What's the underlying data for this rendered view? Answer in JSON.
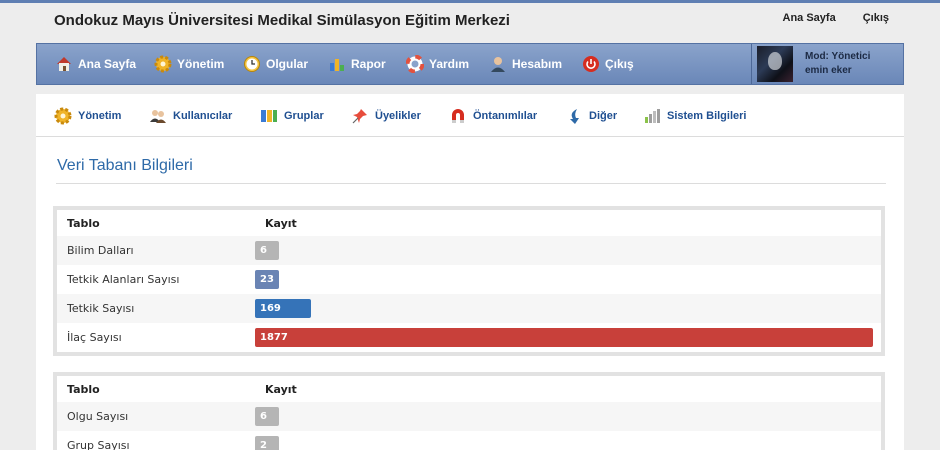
{
  "header": {
    "site_title": "Ondokuz Mayıs Üniversitesi Medikal Simülasyon Eğitim Merkezi",
    "links": [
      "Ana Sayfa",
      "Çıkış"
    ]
  },
  "mainnav": {
    "items": [
      {
        "label": "Ana Sayfa",
        "icon": "home-icon"
      },
      {
        "label": "Yönetim",
        "icon": "gear-icon"
      },
      {
        "label": "Olgular",
        "icon": "clock-icon"
      },
      {
        "label": "Rapor",
        "icon": "bar-chart-icon"
      },
      {
        "label": "Yardım",
        "icon": "lifebuoy-icon"
      },
      {
        "label": "Hesabım",
        "icon": "user-icon"
      },
      {
        "label": "Çıkış",
        "icon": "power-icon"
      }
    ],
    "user": {
      "role": "Mod: Yönetici",
      "name": "emin eker"
    }
  },
  "subnav": {
    "items": [
      {
        "label": "Yönetim",
        "icon": "gear-icon"
      },
      {
        "label": "Kullanıcılar",
        "icon": "users-icon"
      },
      {
        "label": "Gruplar",
        "icon": "groups-icon"
      },
      {
        "label": "Üyelikler",
        "icon": "pushpin-icon"
      },
      {
        "label": "Öntanımlılar",
        "icon": "magnet-icon"
      },
      {
        "label": "Diğer",
        "icon": "arrow-down-icon"
      },
      {
        "label": "Sistem Bilgileri",
        "icon": "stats-icon"
      }
    ]
  },
  "section": {
    "title": "Veri Tabanı Bilgileri"
  },
  "table1": {
    "headers": [
      "Tablo",
      "Kayıt"
    ],
    "rows": [
      {
        "label": "Bilim Dalları",
        "value": "6",
        "fill": 0.0032,
        "color": "#b5b5b5"
      },
      {
        "label": "Tetkik Alanları Sayısı",
        "value": "23",
        "fill": 0.0123,
        "color": "#6a84b4"
      },
      {
        "label": "Tetkik Sayısı",
        "value": "169",
        "fill": 0.09,
        "color": "#3573b8"
      },
      {
        "label": "İlaç Sayısı",
        "value": "1877",
        "fill": 1.0,
        "color": "#c8403a"
      }
    ]
  },
  "table2": {
    "headers": [
      "Tablo",
      "Kayıt"
    ],
    "rows": [
      {
        "label": "Olgu Sayısı",
        "value": "6",
        "fill": 0.0032,
        "color": "#b5b5b5"
      },
      {
        "label": "Grup Sayısı",
        "value": "2",
        "fill": 0.001,
        "color": "#b5b5b5"
      }
    ]
  }
}
